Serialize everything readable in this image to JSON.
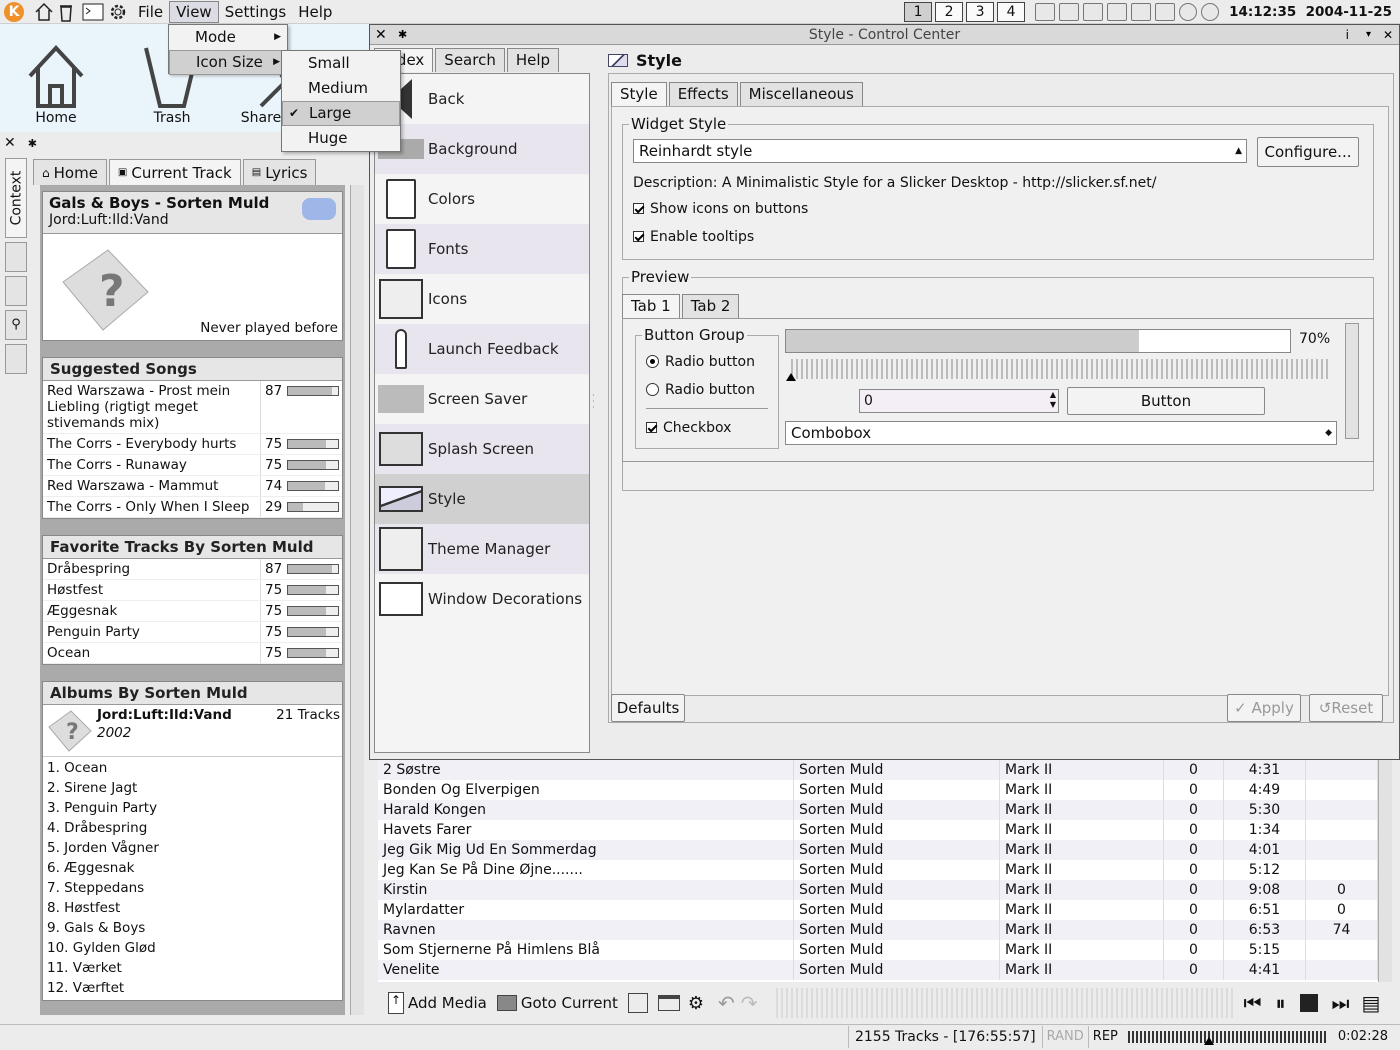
{
  "panel": {
    "menu": [
      "File",
      "View",
      "Settings",
      "Help"
    ],
    "desktops": [
      "1",
      "2",
      "3",
      "4"
    ],
    "clock": "14:12:35  2004-11-25"
  },
  "desktop": {
    "icons": [
      "Home",
      "Trash",
      "Share"
    ]
  },
  "view_menu": {
    "items": [
      "Mode",
      "Icon Size"
    ]
  },
  "icon_size_menu": {
    "items": [
      "Small",
      "Medium",
      "Large",
      "Huge"
    ],
    "checked": "Large"
  },
  "amarok": {
    "vtabs": [
      "Context"
    ],
    "tabs": [
      "Home",
      "Current Track",
      "Lyrics"
    ],
    "current": {
      "title": "Gals & Boys - Sorten Muld",
      "album": "Jord:Luft:Ild:Vand",
      "played": "Never played before"
    },
    "suggested": {
      "header": "Suggested Songs",
      "rows": [
        {
          "title": "Red Warszawa - Prost mein Liebling (rigtigt meget stivemands mix)",
          "score": "87",
          "v": 87
        },
        {
          "title": "The Corrs - Everybody hurts",
          "score": "75",
          "v": 75
        },
        {
          "title": "The Corrs - Runaway",
          "score": "75",
          "v": 75
        },
        {
          "title": "Red Warszawa - Mammut",
          "score": "74",
          "v": 74
        },
        {
          "title": "The Corrs - Only When I Sleep",
          "score": "29",
          "v": 29
        }
      ]
    },
    "favorites": {
      "header": "Favorite Tracks By Sorten Muld",
      "rows": [
        {
          "title": "Dråbespring",
          "score": "87",
          "v": 87
        },
        {
          "title": "Høstfest",
          "score": "75",
          "v": 75
        },
        {
          "title": "Æggesnak",
          "score": "75",
          "v": 75
        },
        {
          "title": "Penguin Party",
          "score": "75",
          "v": 75
        },
        {
          "title": "Ocean",
          "score": "75",
          "v": 75
        }
      ]
    },
    "albums": {
      "header": "Albums By Sorten Muld",
      "name": "Jord:Luft:Ild:Vand",
      "tracks": "21 Tracks",
      "year": "2002",
      "list": [
        "1. Ocean",
        "2. Sirene Jagt",
        "3. Penguin Party",
        "4. Dråbespring",
        "5. Jorden Vågner",
        "6. Æggesnak",
        "7. Steppedans",
        "8. Høstfest",
        "9. Gals & Boys",
        "10. Gylden Glød",
        "11. Værket",
        "12. Værftet"
      ]
    }
  },
  "playlist": {
    "rows": [
      [
        "2 Søstre",
        "Sorten Muld",
        "Mark II",
        "0",
        "4:31",
        ""
      ],
      [
        "Bonden Og Elverpigen",
        "Sorten Muld",
        "Mark II",
        "0",
        "4:49",
        ""
      ],
      [
        "Harald Kongen",
        "Sorten Muld",
        "Mark II",
        "0",
        "5:30",
        ""
      ],
      [
        "Havets Farer",
        "Sorten Muld",
        "Mark II",
        "0",
        "1:34",
        ""
      ],
      [
        "Jeg Gik Mig Ud En Sommerdag",
        "Sorten Muld",
        "Mark II",
        "0",
        "4:01",
        ""
      ],
      [
        "Jeg Kan Se På Dine Øjne.......",
        "Sorten Muld",
        "Mark II",
        "0",
        "5:12",
        ""
      ],
      [
        "Kirstin",
        "Sorten Muld",
        "Mark II",
        "0",
        "9:08",
        "0"
      ],
      [
        "Mylardatter",
        "Sorten Muld",
        "Mark II",
        "0",
        "6:51",
        "0"
      ],
      [
        "Ravnen",
        "Sorten Muld",
        "Mark II",
        "0",
        "6:53",
        "74"
      ],
      [
        "Som Stjernerne På Himlens Blå",
        "Sorten Muld",
        "Mark II",
        "0",
        "5:15",
        ""
      ],
      [
        "Venelite",
        "Sorten Muld",
        "Mark II",
        "0",
        "4:41",
        ""
      ]
    ]
  },
  "toolbar": {
    "add_media": "Add Media",
    "goto_current": "Goto Current"
  },
  "status": {
    "tracks": "2155 Tracks - [176:55:57]",
    "rand": "RAND",
    "rep": "REP",
    "time": "0:02:28"
  },
  "cc": {
    "title": "Style - Control Center",
    "sidetabs": [
      "Index",
      "Search",
      "Help"
    ],
    "items": [
      "Back",
      "Background",
      "Colors",
      "Fonts",
      "Icons",
      "Launch Feedback",
      "Screen Saver",
      "Splash Screen",
      "Style",
      "Theme Manager",
      "Window Decorations"
    ],
    "selected": "Style",
    "header": "Style",
    "tabs": [
      "Style",
      "Effects",
      "Miscellaneous"
    ],
    "widget_style": {
      "legend": "Widget Style",
      "value": "Reinhardt style",
      "configure": "Configure...",
      "description": "Description: A Minimalistic Style for a Slicker Desktop - http://slicker.sf.net/",
      "show_icons": "Show icons on buttons",
      "tooltips": "Enable tooltips"
    },
    "preview": {
      "legend": "Preview",
      "tabs": [
        "Tab 1",
        "Tab 2"
      ],
      "group": "Button Group",
      "radio1": "Radio button",
      "radio2": "Radio button",
      "checkbox": "Checkbox",
      "progress_label": "70%",
      "progress": 0.7,
      "spin": "0",
      "button": "Button",
      "combobox": "Combobox"
    },
    "defaults": "Defaults",
    "apply": "Apply",
    "reset": "Reset"
  },
  "colors": {
    "selection": "#d0d0d0",
    "playlist_alt": "#f0f0f6",
    "desktop": "#eaf4fb"
  }
}
